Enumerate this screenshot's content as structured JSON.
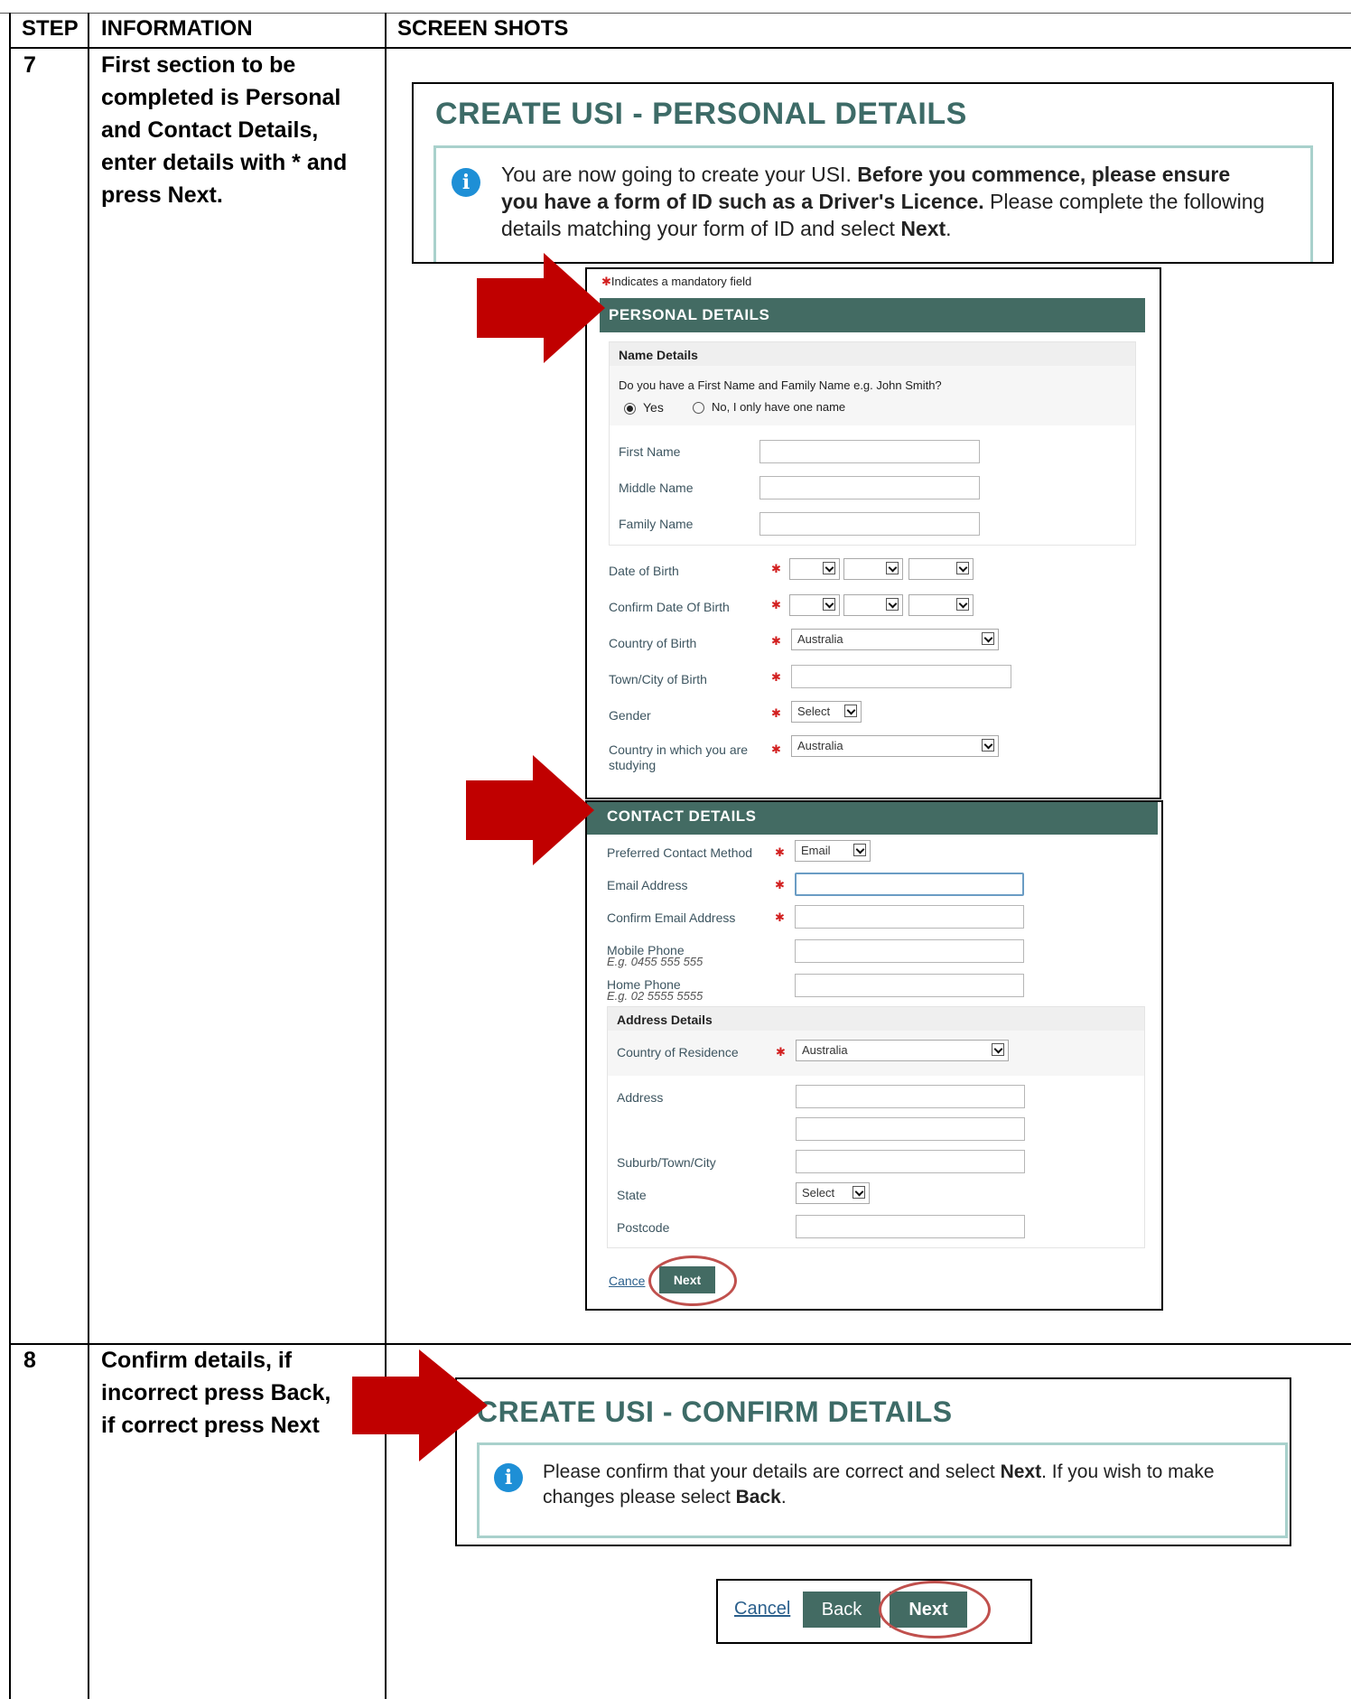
{
  "table": {
    "col_step": "STEP",
    "col_info": "INFORMATION",
    "col_shots": "SCREEN SHOTS"
  },
  "steps": [
    {
      "number": "7",
      "info_lines": [
        "First section to be",
        "completed is Personal",
        "and Contact Details,",
        "enter details with * and",
        "press Next."
      ]
    },
    {
      "number": "8",
      "info_lines": [
        "Confirm details, if",
        "incorrect press Back,",
        "if correct press Next"
      ]
    }
  ],
  "personal_banner": {
    "title": "CREATE USI - PERSONAL DETAILS",
    "notice_line1_a": "You are now going to create your USI. ",
    "notice_line1_b": "Before you commence, please ensure",
    "notice_line2_a": "you have a form of ID such as a Driver's Licence.",
    "notice_line2_b": " Please complete the following",
    "notice_line3_a": "details matching your form of ID and select ",
    "notice_line3_b": "Next",
    "notice_line3_c": "."
  },
  "personal_form": {
    "mandatory_note": "Indicates a mandatory field",
    "section_title": "PERSONAL DETAILS",
    "name_details_heading": "Name Details",
    "name_question": "Do you have a First Name and Family Name e.g. John Smith?",
    "radio_yes": "Yes",
    "radio_no": "No, I only have one name",
    "first_name": "First Name",
    "middle_name": "Middle Name",
    "family_name": "Family Name",
    "dob": "Date of Birth",
    "confirm_dob": "Confirm Date Of Birth",
    "country_of_birth": "Country of Birth",
    "country_of_birth_value": "Australia",
    "town_of_birth": "Town/City of Birth",
    "gender": "Gender",
    "gender_value": "Select",
    "country_studying_1": "Country in which you are",
    "country_studying_2": "studying",
    "country_studying_value": "Australia"
  },
  "contact_form": {
    "section_title": "CONTACT DETAILS",
    "preferred_contact": "Preferred Contact Method",
    "preferred_contact_value": "Email",
    "email": "Email Address",
    "confirm_email": "Confirm Email Address",
    "mobile": "Mobile Phone",
    "mobile_hint": "E.g. 0455 555 555",
    "home": "Home Phone",
    "home_hint": "E.g. 02 5555 5555",
    "address_heading": "Address Details",
    "country_residence": "Country of Residence",
    "country_residence_value": "Australia",
    "address": "Address",
    "suburb": "Suburb/Town/City",
    "state": "State",
    "state_value": "Select",
    "postcode": "Postcode",
    "cancel": "Cance",
    "next": "Next"
  },
  "confirm_banner": {
    "title": "CREATE USI - CONFIRM DETAILS",
    "notice_line1_a": "Please confirm that your details are correct and select ",
    "notice_line1_b": "Next",
    "notice_line1_c": ". If you wish to make",
    "notice_line2_a": "changes please select ",
    "notice_line2_b": "Back",
    "notice_line2_c": "."
  },
  "confirm_buttons": {
    "cancel": "Cancel",
    "back": "Back",
    "next": "Next"
  },
  "colors": {
    "accent_teal": "#436b63",
    "title_teal": "#3d6b67",
    "arrow_red": "#c00000",
    "highlight_oval": "#c0504d",
    "info_blue": "#1e8fd6"
  },
  "icons": [
    "info-icon",
    "arrow-right-icon",
    "chevron-down-icon",
    "radio-icon",
    "required-star-icon"
  ]
}
